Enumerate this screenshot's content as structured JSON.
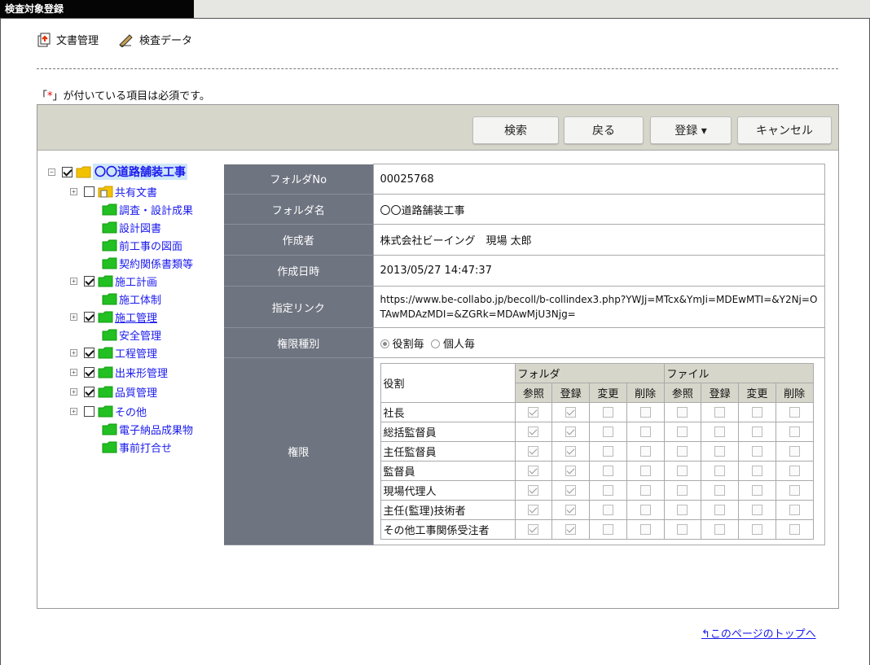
{
  "window_title": "検査対象登録",
  "top_links": [
    {
      "label": "文書管理",
      "icon": "document-upload-icon"
    },
    {
      "label": "検査データ",
      "icon": "pen-edit-icon"
    }
  ],
  "required_note": {
    "prefix": "「",
    "star": "*",
    "suffix": "」が付いている項目は必須です。"
  },
  "toolbar": {
    "search_label": "検索",
    "back_label": "戻る",
    "register_label": "登録 ▾",
    "cancel_label": "キャンセル"
  },
  "tree": {
    "root": "〇〇道路舗装工事",
    "items": [
      {
        "label": "共有文書",
        "expander": "+",
        "checked": false
      },
      {
        "label": "調査・設計成果"
      },
      {
        "label": "設計図書"
      },
      {
        "label": "前工事の図面"
      },
      {
        "label": "契約関係書類等"
      },
      {
        "label": "施工計画",
        "expander": "+",
        "checked": true
      },
      {
        "label": "施工体制"
      },
      {
        "label": "施工管理",
        "expander": "+",
        "checked": true
      },
      {
        "label": "安全管理"
      },
      {
        "label": "工程管理",
        "expander": "+",
        "checked": true
      },
      {
        "label": "出来形管理",
        "expander": "+",
        "checked": true
      },
      {
        "label": "品質管理",
        "expander": "+",
        "checked": true
      },
      {
        "label": "その他",
        "expander": "+",
        "checked": false
      },
      {
        "label": "電子納品成果物"
      },
      {
        "label": "事前打合せ"
      }
    ]
  },
  "details": {
    "folder_no_label": "フォルダNo",
    "folder_no": "00025768",
    "folder_name_label": "フォルダ名",
    "folder_name": "〇〇道路舗装工事",
    "creator_label": "作成者",
    "creator": "株式会社ビーイング　現場 太郎",
    "created_label": "作成日時",
    "created": "2013/05/27 14:47:37",
    "link_label": "指定リンク",
    "link": "https://www.be-collabo.jp/becoll/b-collindex3.php?YWJj=MTcx&YmJi=MDEwMTI=&Y2Nj=OTAwMDAzMDI=&ZGRk=MDAwMjU3Njg=",
    "authtype_label": "権限種別",
    "authtype_options": [
      "役割毎",
      "個人毎"
    ],
    "authtype_selected": "役割毎",
    "permissions_label": "権限"
  },
  "permissions": {
    "role_header": "役割",
    "folder_header": "フォルダ",
    "file_header": "ファイル",
    "sub_headers": [
      "参照",
      "登録",
      "変更",
      "削除",
      "参照",
      "登録",
      "変更",
      "削除"
    ],
    "rows": [
      {
        "role": "社長",
        "checks": [
          true,
          true,
          false,
          false,
          false,
          false,
          false,
          false
        ]
      },
      {
        "role": "総括監督員",
        "checks": [
          true,
          true,
          false,
          false,
          false,
          false,
          false,
          false
        ]
      },
      {
        "role": "主任監督員",
        "checks": [
          true,
          true,
          false,
          false,
          false,
          false,
          false,
          false
        ]
      },
      {
        "role": "監督員",
        "checks": [
          true,
          true,
          false,
          false,
          false,
          false,
          false,
          false
        ]
      },
      {
        "role": "現場代理人",
        "checks": [
          true,
          true,
          false,
          false,
          false,
          false,
          false,
          false
        ]
      },
      {
        "role": "主任(監理)技術者",
        "checks": [
          true,
          true,
          false,
          false,
          false,
          false,
          false,
          false
        ]
      },
      {
        "role": "その他工事関係受注者",
        "checks": [
          true,
          true,
          false,
          false,
          false,
          false,
          false,
          false
        ]
      }
    ]
  },
  "page_top_link": "このページのトップへ",
  "colors": {
    "header_gray": "#6e7480",
    "toolbar": "#d6d6cb",
    "link_blue": "#1a1aee",
    "folder_green": "#22c022",
    "folder_yellow": "#f2c200"
  }
}
